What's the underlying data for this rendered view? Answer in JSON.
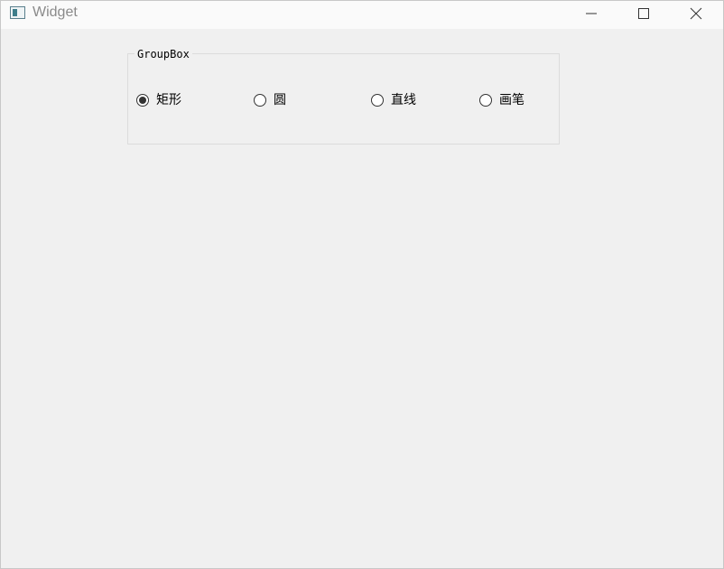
{
  "window": {
    "title": "Widget"
  },
  "groupbox": {
    "title": "GroupBox",
    "options": [
      {
        "label": "矩形",
        "checked": true
      },
      {
        "label": "圆",
        "checked": false
      },
      {
        "label": "直线",
        "checked": false
      },
      {
        "label": "画笔",
        "checked": false
      }
    ]
  },
  "colors": {
    "background": "#f0f0f0",
    "titlebar": "#fafafa",
    "title_text": "#8a8a8a"
  }
}
